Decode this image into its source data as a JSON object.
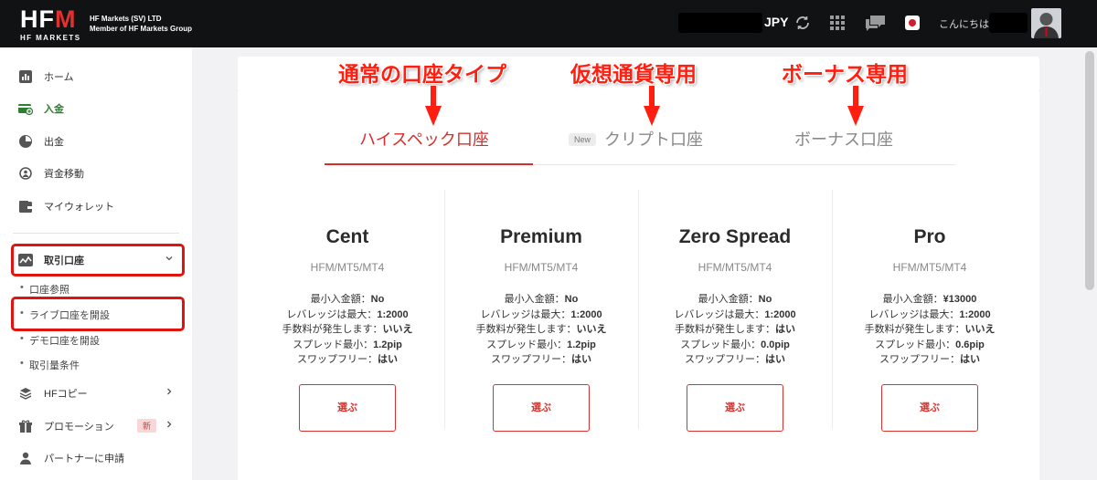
{
  "header": {
    "logo_text_prefix": "HF",
    "logo_text_accent": "M",
    "logo_sub": "HF MARKETS",
    "company_line1": "HF Markets (SV) LTD",
    "company_line2": "Member of HF Markets Group",
    "currency": "JPY",
    "greeting": "こんにちは",
    "icons": [
      "refresh-icon",
      "apps-grid-icon",
      "chat-icon",
      "japan-flag-icon"
    ]
  },
  "sidebar": {
    "items": [
      {
        "label": "ホーム",
        "icon": "chart-icon"
      },
      {
        "label": "入金",
        "icon": "deposit-icon",
        "active": true
      },
      {
        "label": "出金",
        "icon": "withdraw-icon"
      },
      {
        "label": "資金移動",
        "icon": "transfer-icon"
      },
      {
        "label": "マイウォレット",
        "icon": "wallet-icon"
      },
      {
        "label": "取引口座",
        "icon": "trading-account-icon"
      },
      {
        "label": "HFコピー",
        "icon": "layers-icon"
      },
      {
        "label": "プロモーション",
        "icon": "gift-icon",
        "badge": "新"
      },
      {
        "label": "パートナーに申請",
        "icon": "person-icon"
      }
    ],
    "sub_items": [
      "口座参照",
      "ライブ口座を開設",
      "デモ口座を開設",
      "取引量条件"
    ]
  },
  "annotations": {
    "standard": "通常の口座タイプ",
    "crypto": "仮想通貨専用",
    "bonus": "ボーナス専用"
  },
  "tabs": [
    {
      "label": "ハイスペック口座",
      "active": true
    },
    {
      "label": "クリプト口座",
      "badge": "New"
    },
    {
      "label": "ボーナス口座"
    }
  ],
  "accounts": [
    {
      "name": "Cent",
      "platform": "HFM/MT5/MT4",
      "specs": [
        {
          "label": "最小入金額：",
          "value": "No"
        },
        {
          "label": "レバレッジは最大：",
          "value": "1:2000"
        },
        {
          "label": "手数料が発生します：",
          "value": "いいえ"
        },
        {
          "label": "スプレッド最小：",
          "value": "1.2pip"
        },
        {
          "label": "スワップフリー：",
          "value": "はい"
        }
      ],
      "button": "選ぶ"
    },
    {
      "name": "Premium",
      "platform": "HFM/MT5/MT4",
      "specs": [
        {
          "label": "最小入金額：",
          "value": "No"
        },
        {
          "label": "レバレッジは最大：",
          "value": "1:2000"
        },
        {
          "label": "手数料が発生します：",
          "value": "いいえ"
        },
        {
          "label": "スプレッド最小：",
          "value": "1.2pip"
        },
        {
          "label": "スワップフリー：",
          "value": "はい"
        }
      ],
      "button": "選ぶ"
    },
    {
      "name": "Zero Spread",
      "platform": "HFM/MT5/MT4",
      "specs": [
        {
          "label": "最小入金額：",
          "value": "No"
        },
        {
          "label": "レバレッジは最大：",
          "value": "1:2000"
        },
        {
          "label": "手数料が発生します：",
          "value": "はい"
        },
        {
          "label": "スプレッド最小：",
          "value": "0.0pip"
        },
        {
          "label": "スワップフリー：",
          "value": "はい"
        }
      ],
      "button": "選ぶ"
    },
    {
      "name": "Pro",
      "platform": "HFM/MT5/MT4",
      "specs": [
        {
          "label": "最小入金額：",
          "value": "¥13000"
        },
        {
          "label": "レバレッジは最大：",
          "value": "1:2000"
        },
        {
          "label": "手数料が発生します：",
          "value": "いいえ"
        },
        {
          "label": "スプレッド最小：",
          "value": "0.6pip"
        },
        {
          "label": "スワップフリー：",
          "value": "はい"
        }
      ],
      "button": "選ぶ"
    }
  ],
  "colors": {
    "header_bg": "#111214",
    "brand_red": "#d62f2b",
    "annotation_red": "#ff1e10",
    "active_green": "#2f7d32"
  }
}
